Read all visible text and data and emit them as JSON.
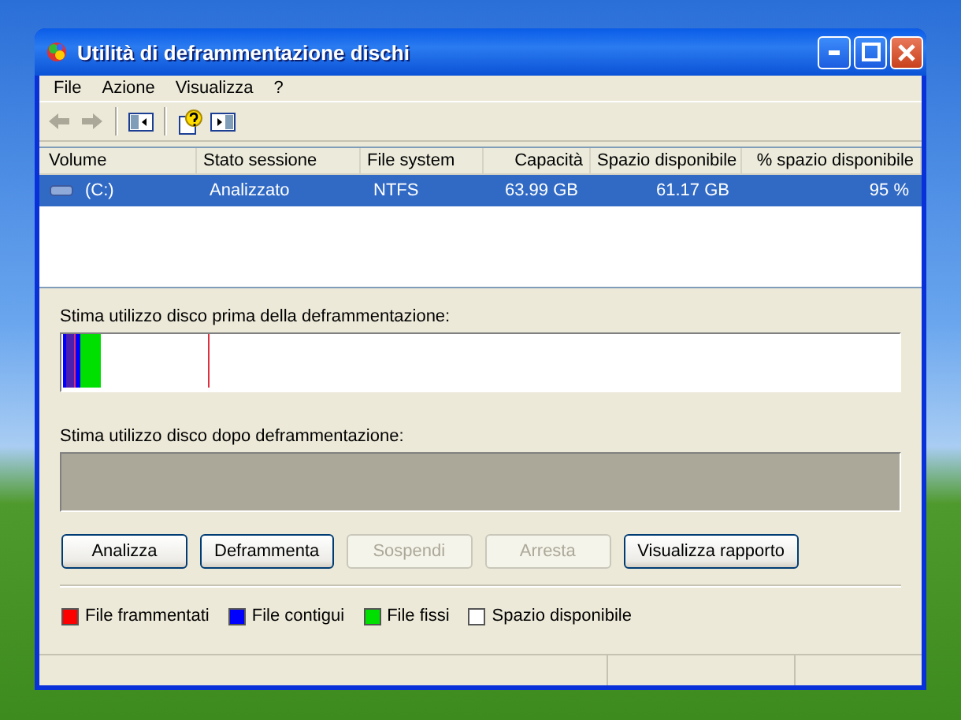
{
  "window": {
    "title": "Utilità di deframmentazione dischi"
  },
  "menu": [
    "File",
    "Azione",
    "Visualizza",
    "?"
  ],
  "toolbar": [
    {
      "kind": "back",
      "disabled": true
    },
    {
      "kind": "forward",
      "disabled": true
    },
    {
      "kind": "separator"
    },
    {
      "kind": "panel-left",
      "disabled": false
    },
    {
      "kind": "separator"
    },
    {
      "kind": "help",
      "disabled": false
    },
    {
      "kind": "panel-right",
      "disabled": false
    }
  ],
  "table": {
    "columns": [
      "Volume",
      "Stato sessione",
      "File system",
      "Capacità",
      "Spazio disponibile",
      "% spazio disponibile"
    ],
    "rows": [
      {
        "selected": true,
        "cells": [
          "(C:)",
          "Analizzato",
          "NTFS",
          "63.99 GB",
          "61.17 GB",
          "95 %"
        ]
      }
    ]
  },
  "before_label": "Stima utilizzo disco prima della deframmentazione:",
  "after_label": "Stima utilizzo disco dopo deframmentazione:",
  "buttons": [
    {
      "label": "Analizza",
      "disabled": false
    },
    {
      "label": "Deframmenta",
      "disabled": false
    },
    {
      "label": "Sospendi",
      "disabled": true
    },
    {
      "label": "Arresta",
      "disabled": true
    },
    {
      "label": "Visualizza rapporto",
      "disabled": false
    }
  ],
  "legend": [
    {
      "label": "File frammentati",
      "color": "#ff0000"
    },
    {
      "label": "File contigui",
      "color": "#0000ff"
    },
    {
      "label": "File fissi",
      "color": "#00e000"
    },
    {
      "label": "Spazio disponibile",
      "color": "#ffffff"
    }
  ]
}
